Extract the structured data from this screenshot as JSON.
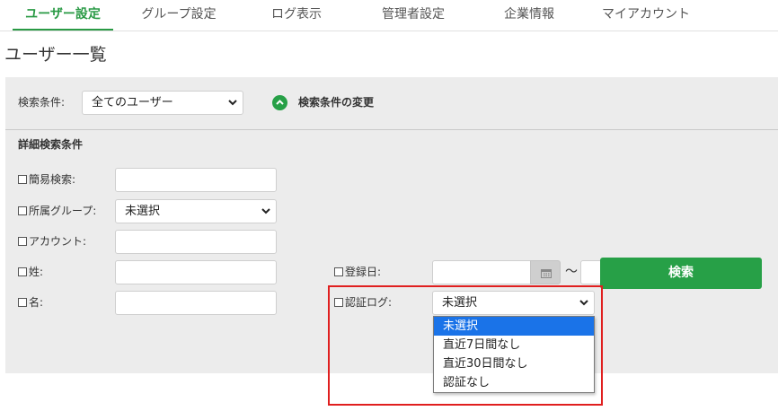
{
  "nav": {
    "tabs": [
      {
        "label": "ユーザー設定",
        "active": true
      },
      {
        "label": "グループ設定"
      },
      {
        "label": "ログ表示"
      },
      {
        "label": "管理者設定"
      },
      {
        "label": "企業情報"
      },
      {
        "label": "マイアカウント"
      }
    ]
  },
  "page": {
    "title": "ユーザー一覧"
  },
  "search": {
    "condition_label": "検索条件:",
    "condition_value": "全てのユーザー",
    "toggle_label": "検索条件の変更",
    "detail_heading": "詳細検索条件",
    "fields": {
      "simple_label": "簡易検索:",
      "group_label": "所属グループ:",
      "group_value": "未選択",
      "account_label": "アカウント:",
      "lastname_label": "姓:",
      "firstname_label": "名:",
      "regdate_label": "登録日:",
      "regdate_separator": "～",
      "authlog_label": "認証ログ:",
      "authlog_value": "未選択"
    },
    "authlog_options": [
      {
        "label": "未選択",
        "selected": true
      },
      {
        "label": "直近7日間なし"
      },
      {
        "label": "直近30日間なし"
      },
      {
        "label": "認証なし"
      }
    ],
    "search_button": "検索"
  },
  "colors": {
    "accent": "#27a047",
    "highlight": "#e01f1f",
    "selected_option": "#1a73e8"
  },
  "icons": {
    "toggle": "chevron-up-circle-icon",
    "calendar": "calendar-icon",
    "select": "chevron-down-icon"
  }
}
